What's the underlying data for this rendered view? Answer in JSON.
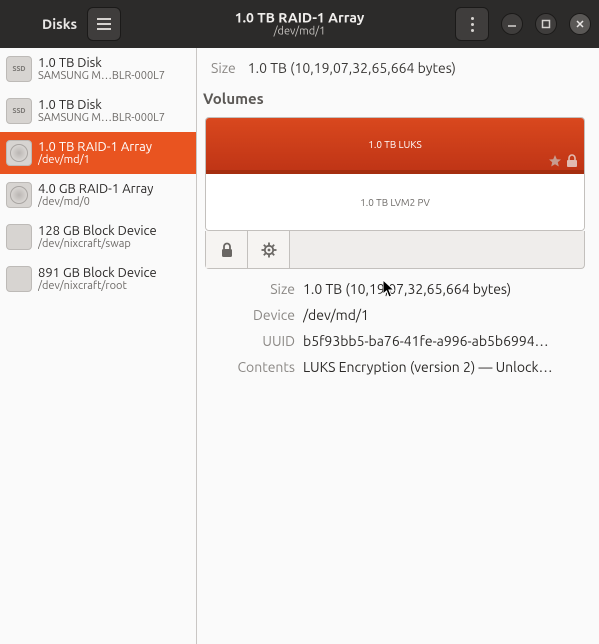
{
  "header": {
    "app_title": "Disks",
    "center_title": "1.0 TB RAID-1 Array",
    "center_subtitle": "/dev/md/1"
  },
  "sidebar": {
    "items": [
      {
        "title": "1.0 TB Disk",
        "subtitle": "SAMSUNG M…BLR-000L7",
        "icon": "ssd"
      },
      {
        "title": "1.0 TB Disk",
        "subtitle": "SAMSUNG M…BLR-000L7",
        "icon": "ssd"
      },
      {
        "title": "1.0 TB RAID-1 Array",
        "subtitle": "/dev/md/1",
        "icon": "raid",
        "selected": true
      },
      {
        "title": "4.0 GB RAID-1 Array",
        "subtitle": "/dev/md/0",
        "icon": "raid"
      },
      {
        "title": "128 GB Block Device",
        "subtitle": "/dev/nixcraft/swap",
        "icon": "block"
      },
      {
        "title": "891 GB Block Device",
        "subtitle": "/dev/nixcraft/root",
        "icon": "block"
      }
    ]
  },
  "top": {
    "size_label": "Size",
    "size_value": "1.0 TB (10,19,07,32,65,664 bytes)"
  },
  "volumes": {
    "heading": "Volumes",
    "upper_label": "1.0 TB LUKS",
    "lower_label": "1.0 TB LVM2 PV"
  },
  "info": {
    "size_label": "Size",
    "size_value": "1.0 TB (10,19,07,32,65,664 bytes)",
    "device_label": "Device",
    "device_value": "/dev/md/1",
    "uuid_label": "UUID",
    "uuid_value": "b5f93bb5-ba76-41fe-a996-ab5b6994…",
    "contents_label": "Contents",
    "contents_value": "LUKS Encryption (version 2) — Unlock…"
  }
}
